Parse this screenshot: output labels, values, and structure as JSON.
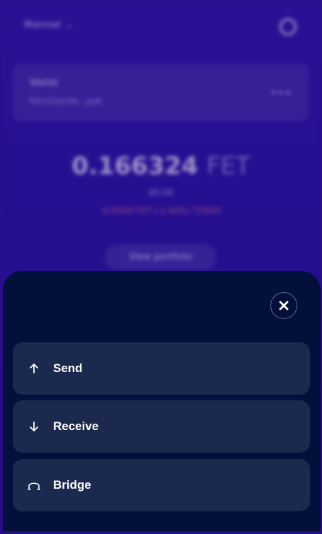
{
  "background": {
    "network": "Mainnet",
    "account_name": "Wallet",
    "account_address": "fetch1qn4e...pwt",
    "balance_amount": "0.166324",
    "balance_unit": "FET",
    "fiat_value": "$0.04",
    "daily_change": "-0.0040 FET (-2.40%) TODAY",
    "portfolio_button": "View portfolio"
  },
  "sheet": {
    "close_icon": "close-icon",
    "actions": [
      {
        "label": "Send",
        "icon": "arrow-up-icon"
      },
      {
        "label": "Receive",
        "icon": "arrow-down-icon"
      },
      {
        "label": "Bridge",
        "icon": "bridge-icon"
      }
    ]
  },
  "colors": {
    "sheet_background": "#02103b",
    "action_background": "#1c294e",
    "app_gradient_top": "#2d12a0"
  }
}
